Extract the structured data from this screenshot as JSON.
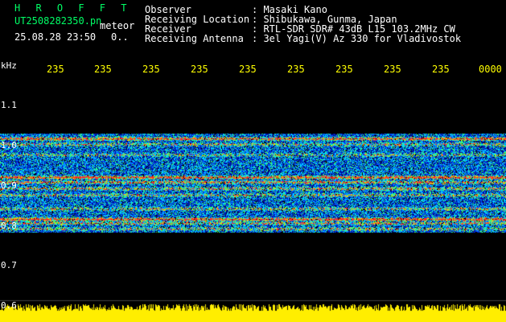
{
  "program": {
    "title": "H R O F F T",
    "filename": "UT2508282350.pn",
    "suffix": "meteor",
    "datetime": "25.08.28 23:50",
    "extra": "0.."
  },
  "info": {
    "labels": [
      "Observer",
      "Receiving Location",
      "Receiver",
      "Receiving Antenna"
    ],
    "values": [
      ": Masaki Kano",
      ": Shibukawa, Gunma, Japan",
      ": RTL-SDR SDR# 43dB L15 103.2MHz CW",
      ": 3el Yagi(V) Az 330 for Vladivostok"
    ]
  },
  "axis": {
    "unit": "kHz",
    "time_ticks": [
      "235",
      "235",
      "235",
      "235",
      "235",
      "235",
      "235",
      "235",
      "235",
      "0000"
    ],
    "freq_ticks": [
      "1.1",
      "1.0",
      "0.9",
      "0.8",
      "0.7",
      "0.6"
    ]
  },
  "colors": {
    "header_green": "#00ff66",
    "tick_yellow": "#ffff00",
    "background": "#000000",
    "noise_band": "#ffee00"
  }
}
